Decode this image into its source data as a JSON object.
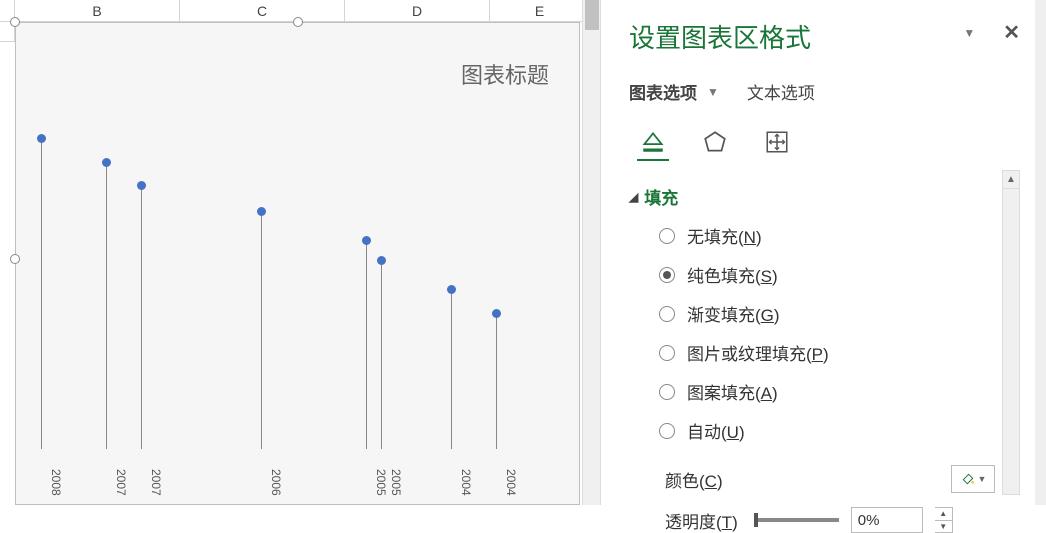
{
  "columns": {
    "b": "B",
    "c": "C",
    "d": "D",
    "e": "E"
  },
  "chart": {
    "title": "图表标题"
  },
  "chart_data": {
    "type": "lollipop",
    "categories": [
      "2008",
      "2007",
      "2007",
      "2006",
      "2005",
      "2005",
      "2004",
      "2004"
    ],
    "values": [
      320,
      295,
      272,
      245,
      215,
      195,
      165,
      140
    ],
    "title": "图表标题",
    "xlabel": "",
    "ylabel": "",
    "ylim": [
      0,
      350
    ]
  },
  "panel": {
    "title": "设置图表区格式",
    "tab_chart": "图表选项",
    "tab_text": "文本选项",
    "section_fill": "填充",
    "fill_none": "无填充",
    "fill_solid": "纯色填充",
    "fill_gradient": "渐变填充",
    "fill_picture": "图片或纹理填充",
    "fill_pattern": "图案填充",
    "fill_auto": "自动",
    "hk_none": "N",
    "hk_solid": "S",
    "hk_gradient": "G",
    "hk_picture": "P",
    "hk_pattern": "A",
    "hk_auto": "U",
    "color_label": "颜色",
    "hk_color": "C",
    "trans_label": "透明度",
    "hk_trans": "T",
    "trans_value": "0%"
  }
}
